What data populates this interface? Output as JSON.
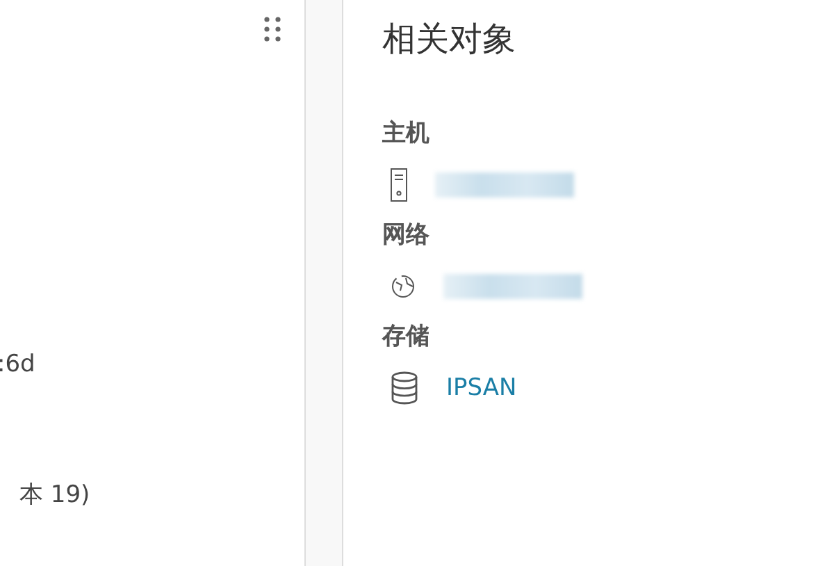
{
  "left_panel": {
    "lines": [
      ":6d",
      "本 19)"
    ]
  },
  "related_objects": {
    "title": "相关对象",
    "sections": [
      {
        "heading": "主机",
        "items": [
          {
            "kind": "host",
            "redacted": true
          }
        ]
      },
      {
        "heading": "网络",
        "items": [
          {
            "kind": "network",
            "redacted": true
          }
        ]
      },
      {
        "heading": "存储",
        "items": [
          {
            "kind": "datastore",
            "redacted": false,
            "name": "IPSAN"
          }
        ]
      }
    ]
  }
}
